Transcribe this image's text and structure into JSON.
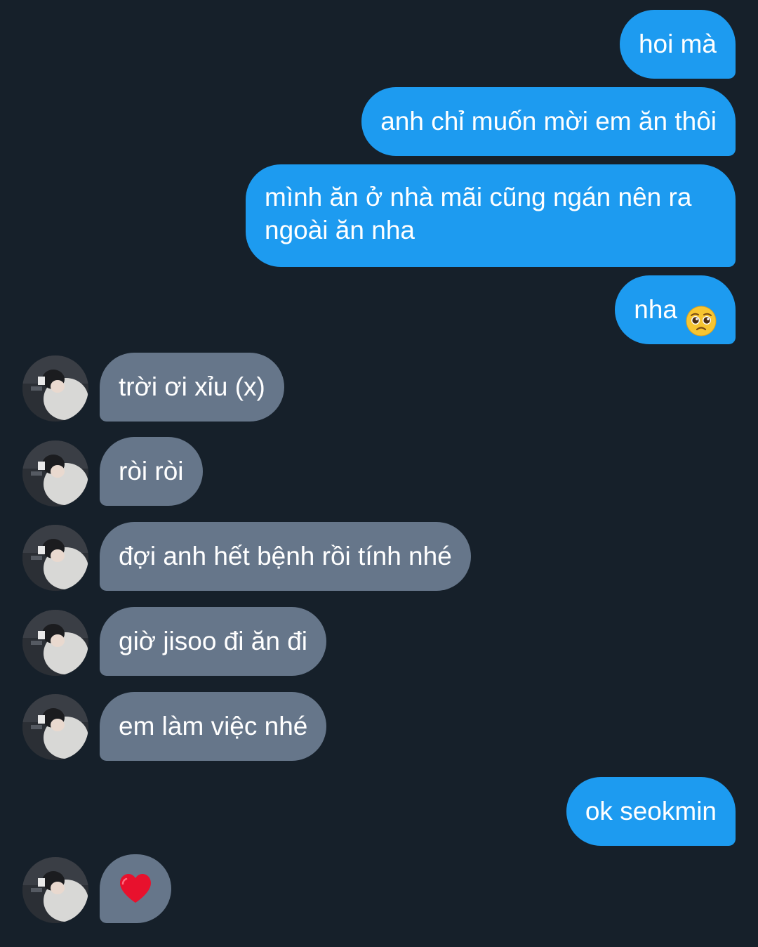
{
  "chat": {
    "messages": [
      {
        "side": "out",
        "text": "hoi mà"
      },
      {
        "side": "out",
        "text": "anh chỉ muốn mời em ăn thôi"
      },
      {
        "side": "out",
        "text": "mình ăn ở nhà mãi cũng ngán nên ra ngoài ăn nha"
      },
      {
        "side": "out",
        "text": "nha",
        "emoji": "pleading-face-emoji"
      },
      {
        "side": "in",
        "text": "trời ơi xỉu (x)"
      },
      {
        "side": "in",
        "text": "ròi ròi"
      },
      {
        "side": "in",
        "text": "đợi anh hết bệnh rồi tính nhé"
      },
      {
        "side": "in",
        "text": "giờ jisoo đi ăn đi"
      },
      {
        "side": "in",
        "text": "em làm việc nhé"
      },
      {
        "side": "out",
        "text": "ok seokmin"
      },
      {
        "side": "in",
        "emoji": "red-heart-emoji"
      }
    ]
  },
  "colors": {
    "background": "#16202a",
    "outgoing_bubble": "#1d9bf0",
    "incoming_bubble": "#66768a",
    "text": "#ffffff"
  }
}
